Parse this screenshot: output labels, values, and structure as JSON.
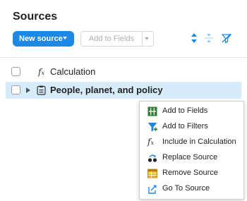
{
  "panel": {
    "title": "Sources"
  },
  "toolbar": {
    "new_source_label": "New source",
    "add_to_fields_label": "Add to Fields",
    "icons": [
      "sort-updown-icon",
      "collapse-icon",
      "filter-off-icon"
    ]
  },
  "sources": [
    {
      "label": "Calculation",
      "icon": "function-icon",
      "selected": false,
      "bold": false
    },
    {
      "label": "People, planet, and policy",
      "icon": "dataset-icon",
      "selected": true,
      "bold": true
    }
  ],
  "context_menu": {
    "items": [
      {
        "label": "Add to Fields",
        "icon": "columns-icon"
      },
      {
        "label": "Add to Filters",
        "icon": "filter-icon"
      },
      {
        "label": "Include in Calculation",
        "icon": "function-icon"
      },
      {
        "label": "Replace Source",
        "icon": "replace-icon"
      },
      {
        "label": "Remove Source",
        "icon": "table-icon"
      },
      {
        "label": "Go To Source",
        "icon": "goto-icon"
      }
    ]
  },
  "colors": {
    "accent": "#1e88e5",
    "selection": "#d7ecfb",
    "green": "#2e7d32"
  }
}
